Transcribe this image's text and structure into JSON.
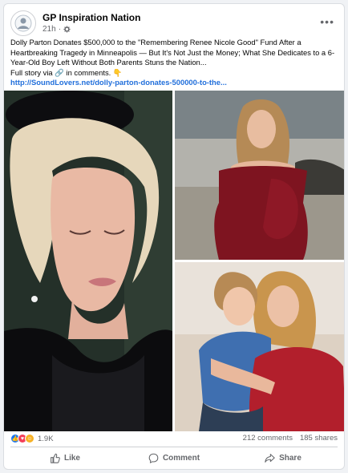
{
  "post": {
    "page_name": "GP Inspiration Nation",
    "time": "21h",
    "separator": "·",
    "text_lines": [
      "Dolly Parton Donates $500,000 to the \"Remembering Renee Nicole Good\" Fund After a",
      "Heartbreaking Tragedy in Minneapolis — But It's Not Just the Money; What She Dedicates to a 6-",
      "Year-Old Boy Left Without Both Parents Stuns the Nation...",
      "Full story via 🔗 in comments. 👇"
    ],
    "link": "http://SoundLovers.net/dolly-parton-donates-500000-to-the..."
  },
  "images": {
    "left_icon": "woman-in-black-portrait",
    "top_right_icon": "woman-in-red-dress-at-beach",
    "bottom_right_icon": "woman-hugging-boy-photo"
  },
  "stats": {
    "reaction_count": "1.9K",
    "comments": "212 comments",
    "shares": "185 shares"
  },
  "actions": {
    "like": "Like",
    "comment": "Comment",
    "share": "Share"
  },
  "colors": {
    "link": "#216fdb",
    "like_reaction": "#1877f2",
    "love_reaction": "#f33e58",
    "care_reaction": "#f7b125"
  }
}
